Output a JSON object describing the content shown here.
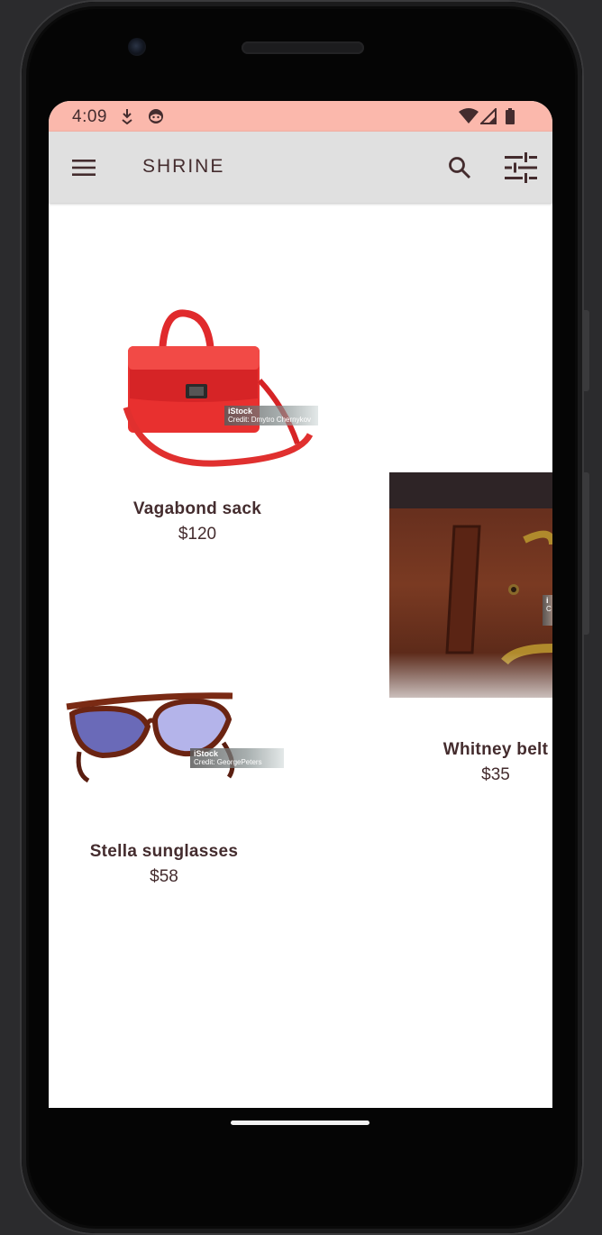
{
  "status_bar": {
    "time": "4:09",
    "background": "#fbb8ac"
  },
  "app_bar": {
    "title": "SHRINE",
    "menu_icon": "menu-icon",
    "search_icon": "search-icon",
    "filter_icon": "tune-icon",
    "background": "#e0e0e0",
    "text_color": "#442c2e"
  },
  "products": [
    {
      "name": "Vagabond sack",
      "price": "$120",
      "watermark": {
        "brand": "iStock",
        "credit": "Credit: Dmytro Chernykov"
      }
    },
    {
      "name": "Whitney belt",
      "price": "$35",
      "watermark": {
        "brand": "i",
        "credit": "C"
      }
    },
    {
      "name": "Stella sunglasses",
      "price": "$58",
      "watermark": {
        "brand": "iStock",
        "credit": "Credit: GeorgePeters"
      }
    }
  ]
}
